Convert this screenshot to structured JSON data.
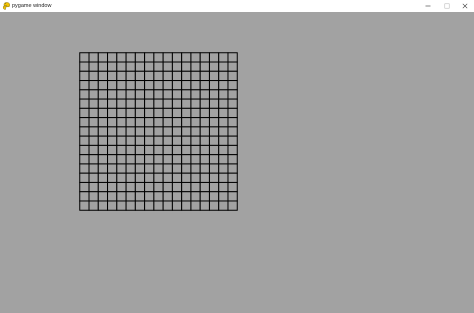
{
  "window": {
    "title": "pygame window",
    "background": "#a2a2a2",
    "titlebar_background": "#ffffff",
    "icon": "pygame-snake-icon",
    "controls": {
      "minimize_icon": "minimize-icon",
      "maximize_icon": "maximize-icon",
      "close_icon": "close-icon"
    }
  },
  "board": {
    "rows": 17,
    "cols": 17,
    "line_color": "#000000",
    "cell_fill": "#a2a2a2"
  }
}
